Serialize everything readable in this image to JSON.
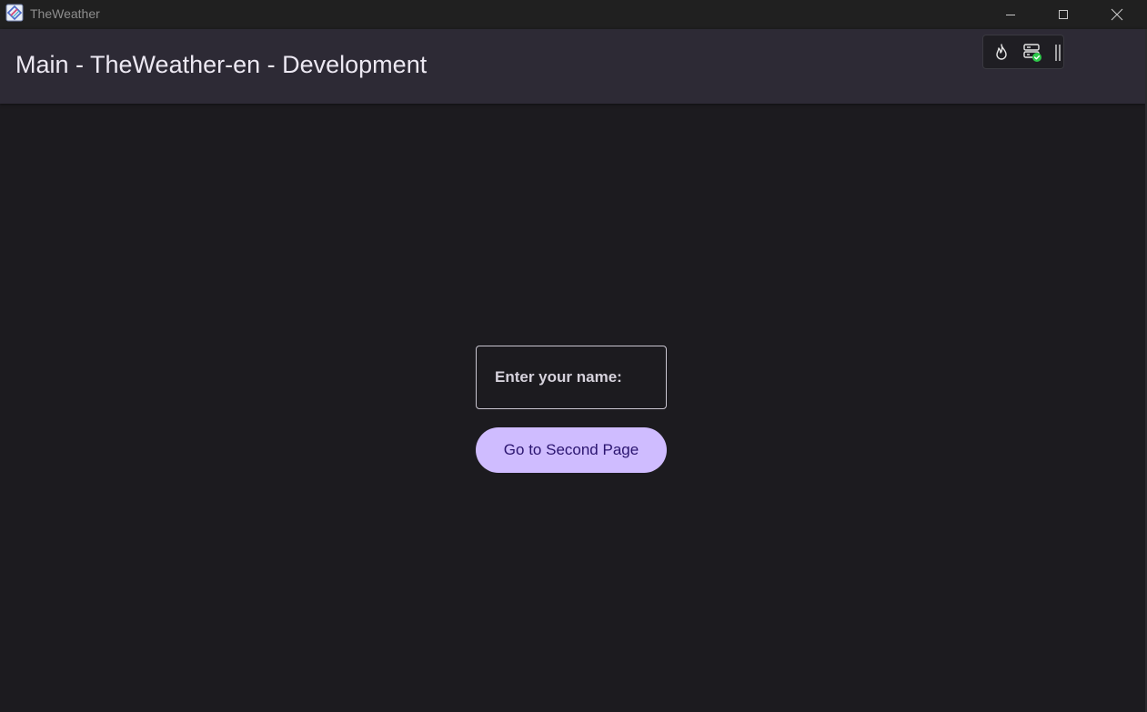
{
  "window": {
    "title": "TheWeather",
    "icon": "app-logo-icon",
    "controls": {
      "minimize_icon": "minimize-icon",
      "maximize_icon": "maximize-icon",
      "close_icon": "close-icon"
    }
  },
  "appbar": {
    "title": "Main - TheWeather-en - Development",
    "debug_toolbar": {
      "icons": [
        "flame-icon",
        "server-status-icon",
        "drag-handle-icon"
      ]
    }
  },
  "main": {
    "name_field": {
      "label": "Enter your name:"
    },
    "go_button": {
      "label": "Go to Second Page"
    }
  },
  "colors": {
    "background": "#1c1b1f",
    "appbar": "#2d2a35",
    "button_bg": "#cfbcff",
    "button_text": "#2b1570",
    "status_ok": "#2ec94a"
  }
}
